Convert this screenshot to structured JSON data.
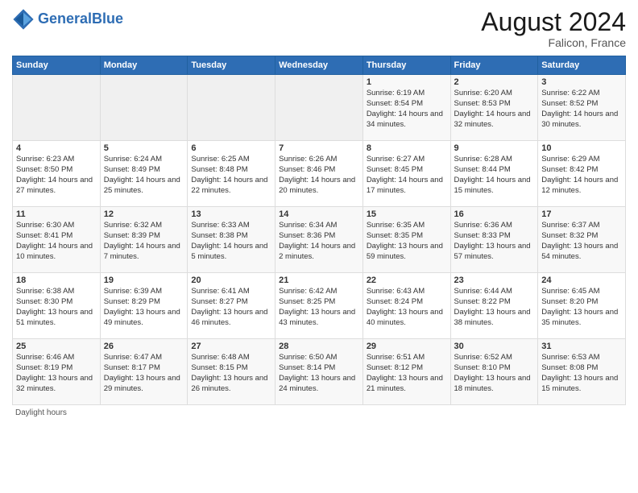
{
  "header": {
    "logo_line1": "General",
    "logo_line2": "Blue",
    "main_title": "August 2024",
    "subtitle": "Falicon, France"
  },
  "days_of_week": [
    "Sunday",
    "Monday",
    "Tuesday",
    "Wednesday",
    "Thursday",
    "Friday",
    "Saturday"
  ],
  "weeks": [
    [
      {
        "day": "",
        "content": ""
      },
      {
        "day": "",
        "content": ""
      },
      {
        "day": "",
        "content": ""
      },
      {
        "day": "",
        "content": ""
      },
      {
        "day": "1",
        "content": "Sunrise: 6:19 AM\nSunset: 8:54 PM\nDaylight: 14 hours and 34 minutes."
      },
      {
        "day": "2",
        "content": "Sunrise: 6:20 AM\nSunset: 8:53 PM\nDaylight: 14 hours and 32 minutes."
      },
      {
        "day": "3",
        "content": "Sunrise: 6:22 AM\nSunset: 8:52 PM\nDaylight: 14 hours and 30 minutes."
      }
    ],
    [
      {
        "day": "4",
        "content": "Sunrise: 6:23 AM\nSunset: 8:50 PM\nDaylight: 14 hours and 27 minutes."
      },
      {
        "day": "5",
        "content": "Sunrise: 6:24 AM\nSunset: 8:49 PM\nDaylight: 14 hours and 25 minutes."
      },
      {
        "day": "6",
        "content": "Sunrise: 6:25 AM\nSunset: 8:48 PM\nDaylight: 14 hours and 22 minutes."
      },
      {
        "day": "7",
        "content": "Sunrise: 6:26 AM\nSunset: 8:46 PM\nDaylight: 14 hours and 20 minutes."
      },
      {
        "day": "8",
        "content": "Sunrise: 6:27 AM\nSunset: 8:45 PM\nDaylight: 14 hours and 17 minutes."
      },
      {
        "day": "9",
        "content": "Sunrise: 6:28 AM\nSunset: 8:44 PM\nDaylight: 14 hours and 15 minutes."
      },
      {
        "day": "10",
        "content": "Sunrise: 6:29 AM\nSunset: 8:42 PM\nDaylight: 14 hours and 12 minutes."
      }
    ],
    [
      {
        "day": "11",
        "content": "Sunrise: 6:30 AM\nSunset: 8:41 PM\nDaylight: 14 hours and 10 minutes."
      },
      {
        "day": "12",
        "content": "Sunrise: 6:32 AM\nSunset: 8:39 PM\nDaylight: 14 hours and 7 minutes."
      },
      {
        "day": "13",
        "content": "Sunrise: 6:33 AM\nSunset: 8:38 PM\nDaylight: 14 hours and 5 minutes."
      },
      {
        "day": "14",
        "content": "Sunrise: 6:34 AM\nSunset: 8:36 PM\nDaylight: 14 hours and 2 minutes."
      },
      {
        "day": "15",
        "content": "Sunrise: 6:35 AM\nSunset: 8:35 PM\nDaylight: 13 hours and 59 minutes."
      },
      {
        "day": "16",
        "content": "Sunrise: 6:36 AM\nSunset: 8:33 PM\nDaylight: 13 hours and 57 minutes."
      },
      {
        "day": "17",
        "content": "Sunrise: 6:37 AM\nSunset: 8:32 PM\nDaylight: 13 hours and 54 minutes."
      }
    ],
    [
      {
        "day": "18",
        "content": "Sunrise: 6:38 AM\nSunset: 8:30 PM\nDaylight: 13 hours and 51 minutes."
      },
      {
        "day": "19",
        "content": "Sunrise: 6:39 AM\nSunset: 8:29 PM\nDaylight: 13 hours and 49 minutes."
      },
      {
        "day": "20",
        "content": "Sunrise: 6:41 AM\nSunset: 8:27 PM\nDaylight: 13 hours and 46 minutes."
      },
      {
        "day": "21",
        "content": "Sunrise: 6:42 AM\nSunset: 8:25 PM\nDaylight: 13 hours and 43 minutes."
      },
      {
        "day": "22",
        "content": "Sunrise: 6:43 AM\nSunset: 8:24 PM\nDaylight: 13 hours and 40 minutes."
      },
      {
        "day": "23",
        "content": "Sunrise: 6:44 AM\nSunset: 8:22 PM\nDaylight: 13 hours and 38 minutes."
      },
      {
        "day": "24",
        "content": "Sunrise: 6:45 AM\nSunset: 8:20 PM\nDaylight: 13 hours and 35 minutes."
      }
    ],
    [
      {
        "day": "25",
        "content": "Sunrise: 6:46 AM\nSunset: 8:19 PM\nDaylight: 13 hours and 32 minutes."
      },
      {
        "day": "26",
        "content": "Sunrise: 6:47 AM\nSunset: 8:17 PM\nDaylight: 13 hours and 29 minutes."
      },
      {
        "day": "27",
        "content": "Sunrise: 6:48 AM\nSunset: 8:15 PM\nDaylight: 13 hours and 26 minutes."
      },
      {
        "day": "28",
        "content": "Sunrise: 6:50 AM\nSunset: 8:14 PM\nDaylight: 13 hours and 24 minutes."
      },
      {
        "day": "29",
        "content": "Sunrise: 6:51 AM\nSunset: 8:12 PM\nDaylight: 13 hours and 21 minutes."
      },
      {
        "day": "30",
        "content": "Sunrise: 6:52 AM\nSunset: 8:10 PM\nDaylight: 13 hours and 18 minutes."
      },
      {
        "day": "31",
        "content": "Sunrise: 6:53 AM\nSunset: 8:08 PM\nDaylight: 13 hours and 15 minutes."
      }
    ]
  ],
  "footer": {
    "daylight_label": "Daylight hours"
  }
}
